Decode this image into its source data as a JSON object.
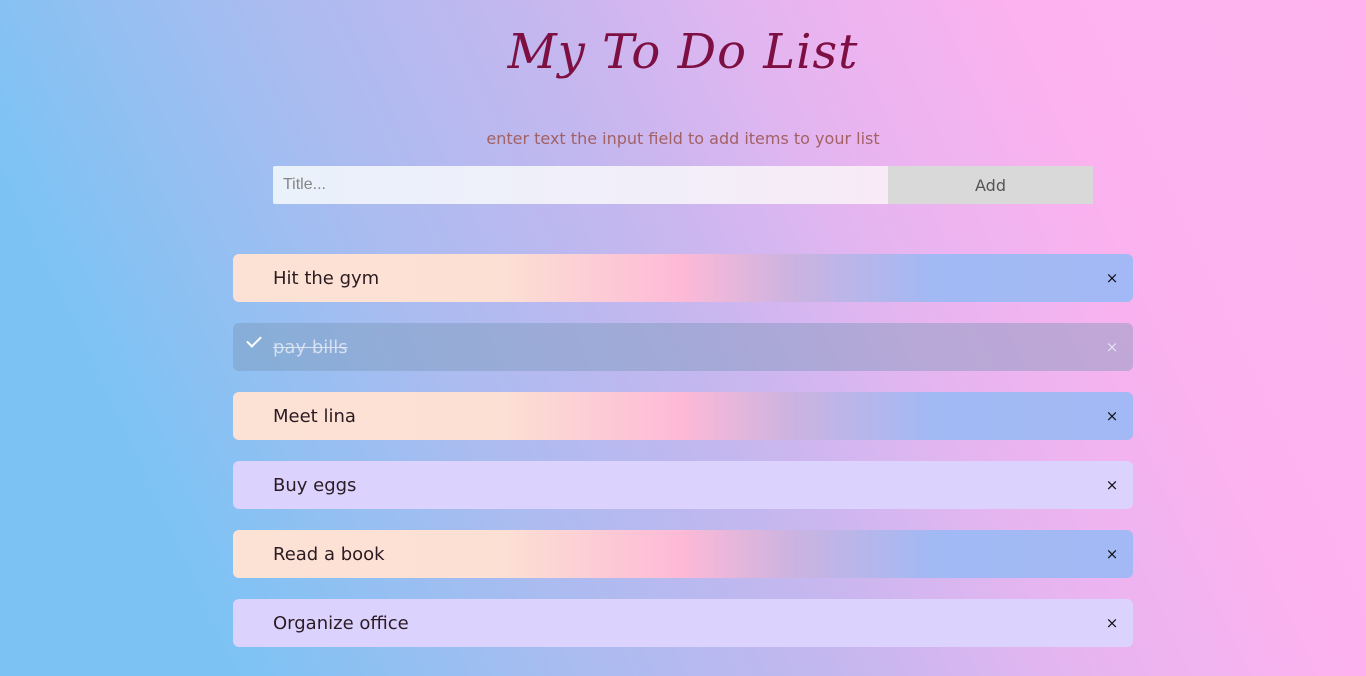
{
  "header": {
    "title": "My To Do List",
    "subtitle": "enter text the input field to add items to your list"
  },
  "form": {
    "input_placeholder": "Title...",
    "input_value": "",
    "add_label": "Add"
  },
  "colors": {
    "title": "#7e0f43",
    "subtitle": "#a26163",
    "item_lavender": "#dcd2fe",
    "add_button": "#d9d9d9"
  },
  "list": {
    "items": [
      {
        "text": "Hit the gym",
        "checked": false,
        "style": "gradient",
        "close": "×",
        "icon": "close-icon"
      },
      {
        "text": "pay bills",
        "checked": true,
        "style": "checked",
        "close": "×",
        "icon": "close-icon"
      },
      {
        "text": "Meet lina",
        "checked": false,
        "style": "gradient",
        "close": "×",
        "icon": "close-icon"
      },
      {
        "text": "Buy eggs",
        "checked": false,
        "style": "lavender",
        "close": "×",
        "icon": "close-icon"
      },
      {
        "text": "Read a book",
        "checked": false,
        "style": "gradient",
        "close": "×",
        "icon": "close-icon"
      },
      {
        "text": "Organize office",
        "checked": false,
        "style": "lavender",
        "close": "×",
        "icon": "close-icon"
      }
    ]
  }
}
